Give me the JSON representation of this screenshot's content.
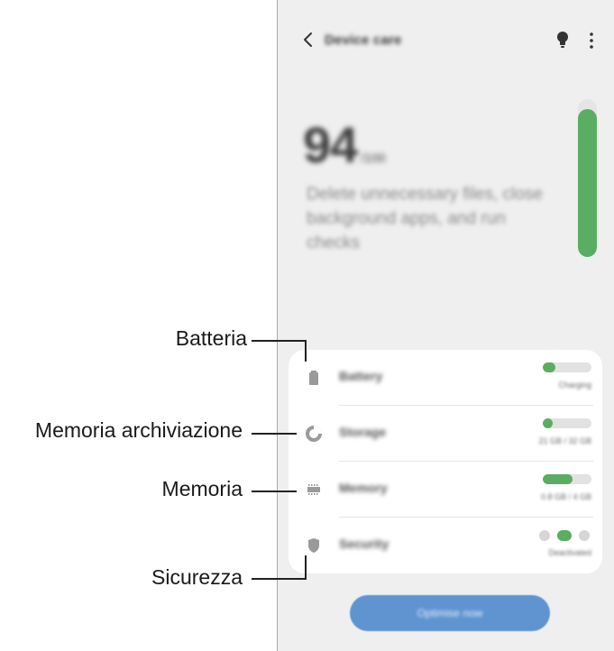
{
  "header": {
    "title": "Device care",
    "back_icon": "chevron-left-icon",
    "tip_icon": "lightbulb-icon",
    "more_icon": "more-vertical-icon"
  },
  "score": {
    "value": "94",
    "unit": "/100",
    "description": "Delete unnecessary files, close background apps, and run checks",
    "level_fraction": 0.94,
    "accent": "#5aad63"
  },
  "items": [
    {
      "label": "Battery",
      "status": "Charging",
      "icon": "battery-icon",
      "level_fraction": 0.25
    },
    {
      "label": "Storage",
      "status": "21 GB / 32 GB",
      "icon": "pie-chart-icon",
      "level_fraction": 0.2
    },
    {
      "label": "Memory",
      "status": "0.8 GB / 4 GB",
      "icon": "memory-chip-icon",
      "level_fraction": 0.62
    },
    {
      "label": "Security",
      "status": "Deactivated",
      "icon": "shield-icon"
    }
  ],
  "optimize_button": {
    "label": "Optimise now",
    "color": "#5f94d1"
  },
  "callouts": {
    "battery": "Batteria",
    "storage": "Memoria archiviazione",
    "memory": "Memoria",
    "security": "Sicurezza"
  }
}
